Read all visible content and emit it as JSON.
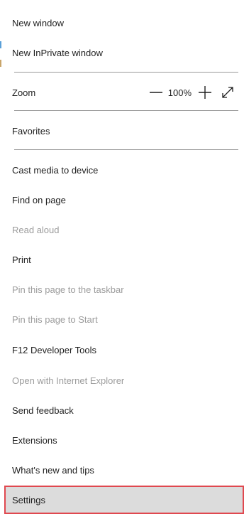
{
  "menu": {
    "new_window": "New window",
    "new_inprivate": "New InPrivate window",
    "zoom": {
      "label": "Zoom",
      "value": "100%",
      "decrease_icon": "minus-icon",
      "increase_icon": "plus-icon",
      "fullscreen_icon": "expand-icon"
    },
    "favorites": "Favorites",
    "cast": "Cast media to device",
    "find": "Find on page",
    "read_aloud": "Read aloud",
    "print": "Print",
    "pin_taskbar": "Pin this page to the taskbar",
    "pin_start": "Pin this page to Start",
    "devtools": "F12 Developer Tools",
    "open_ie": "Open with Internet Explorer",
    "feedback": "Send feedback",
    "extensions": "Extensions",
    "whats_new": "What's new and tips",
    "settings": "Settings"
  },
  "colors": {
    "highlight_bg": "#dcdcdc",
    "highlight_border": "#e0484f",
    "disabled_text": "#9c9c9c",
    "accent_edge": "#5aa0d8"
  }
}
